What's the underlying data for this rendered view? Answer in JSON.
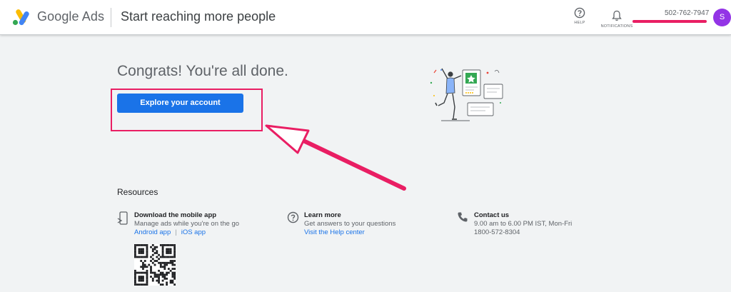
{
  "header": {
    "brand_name": "Google Ads",
    "page_title": "Start reaching more people",
    "help_label": "HELP",
    "notifications_label": "NOTIFICATIONS",
    "account_id": "502-762-7947",
    "avatar_initial": "S",
    "avatar_color": "#9334e6"
  },
  "main": {
    "congrats_text": "Congrats! You're all done.",
    "explore_button_label": "Explore your account"
  },
  "resources": {
    "title": "Resources",
    "mobile_app": {
      "heading": "Download the mobile app",
      "description": "Manage ads while you're on the go",
      "android_link": "Android app",
      "separator": "|",
      "ios_link": "iOS app",
      "icon": "phone-download-icon"
    },
    "learn_more": {
      "heading": "Learn more",
      "description": "Get answers to your questions",
      "link": "Visit the Help center",
      "icon": "help-circle-icon"
    },
    "contact": {
      "heading": "Contact us",
      "hours": "9.00 am to 6.00 PM IST, Mon-Fri",
      "phone": "1800-572-8304",
      "icon": "phone-icon"
    }
  },
  "colors": {
    "accent": "#1a73e8",
    "annotation": "#e91e63",
    "background": "#f1f3f4"
  }
}
